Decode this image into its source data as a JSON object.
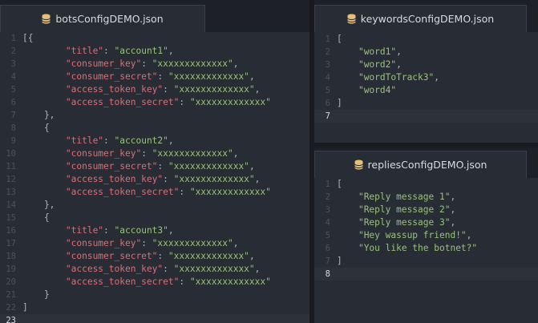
{
  "colors": {
    "key": "#e06c75",
    "string": "#98c379",
    "punctuation": "#abb2bf",
    "line_number": "#4b5263",
    "icon": "#e5c07b"
  },
  "left_pane": {
    "tab_title": "botsConfigDEMO.json",
    "tab_icon": "database-icon",
    "lines": [
      {
        "n": "1",
        "t": [
          [
            "p",
            "[{"
          ]
        ]
      },
      {
        "n": "2",
        "t": [
          [
            "p",
            "        "
          ],
          [
            "k",
            "\"title\""
          ],
          [
            "p",
            ": "
          ],
          [
            "s",
            "\"account1\""
          ],
          [
            "p",
            ","
          ]
        ]
      },
      {
        "n": "3",
        "t": [
          [
            "p",
            "        "
          ],
          [
            "k",
            "\"consumer_key\""
          ],
          [
            "p",
            ": "
          ],
          [
            "s",
            "\"xxxxxxxxxxxxx\""
          ],
          [
            "p",
            ","
          ]
        ]
      },
      {
        "n": "4",
        "t": [
          [
            "p",
            "        "
          ],
          [
            "k",
            "\"consumer_secret\""
          ],
          [
            "p",
            ": "
          ],
          [
            "s",
            "\"xxxxxxxxxxxxx\""
          ],
          [
            "p",
            ","
          ]
        ]
      },
      {
        "n": "5",
        "t": [
          [
            "p",
            "        "
          ],
          [
            "k",
            "\"access_token_key\""
          ],
          [
            "p",
            ": "
          ],
          [
            "s",
            "\"xxxxxxxxxxxxx\""
          ],
          [
            "p",
            ","
          ]
        ]
      },
      {
        "n": "6",
        "t": [
          [
            "p",
            "        "
          ],
          [
            "k",
            "\"access_token_secret\""
          ],
          [
            "p",
            ": "
          ],
          [
            "s",
            "\"xxxxxxxxxxxxx\""
          ]
        ]
      },
      {
        "n": "7",
        "t": [
          [
            "p",
            "    },"
          ]
        ]
      },
      {
        "n": "8",
        "t": [
          [
            "p",
            "    {"
          ]
        ]
      },
      {
        "n": "9",
        "t": [
          [
            "p",
            "        "
          ],
          [
            "k",
            "\"title\""
          ],
          [
            "p",
            ": "
          ],
          [
            "s",
            "\"account2\""
          ],
          [
            "p",
            ","
          ]
        ]
      },
      {
        "n": "10",
        "t": [
          [
            "p",
            "        "
          ],
          [
            "k",
            "\"consumer_key\""
          ],
          [
            "p",
            ": "
          ],
          [
            "s",
            "\"xxxxxxxxxxxxx\""
          ],
          [
            "p",
            ","
          ]
        ]
      },
      {
        "n": "11",
        "t": [
          [
            "p",
            "        "
          ],
          [
            "k",
            "\"consumer_secret\""
          ],
          [
            "p",
            ": "
          ],
          [
            "s",
            "\"xxxxxxxxxxxxx\""
          ],
          [
            "p",
            ","
          ]
        ]
      },
      {
        "n": "12",
        "t": [
          [
            "p",
            "        "
          ],
          [
            "k",
            "\"access_token_key\""
          ],
          [
            "p",
            ": "
          ],
          [
            "s",
            "\"xxxxxxxxxxxxx\""
          ],
          [
            "p",
            ","
          ]
        ]
      },
      {
        "n": "13",
        "t": [
          [
            "p",
            "        "
          ],
          [
            "k",
            "\"access_token_secret\""
          ],
          [
            "p",
            ": "
          ],
          [
            "s",
            "\"xxxxxxxxxxxxx\""
          ]
        ]
      },
      {
        "n": "14",
        "t": [
          [
            "p",
            "    },"
          ]
        ]
      },
      {
        "n": "15",
        "t": [
          [
            "p",
            "    {"
          ]
        ]
      },
      {
        "n": "16",
        "t": [
          [
            "p",
            "        "
          ],
          [
            "k",
            "\"title\""
          ],
          [
            "p",
            ": "
          ],
          [
            "s",
            "\"account3\""
          ],
          [
            "p",
            ","
          ]
        ]
      },
      {
        "n": "17",
        "t": [
          [
            "p",
            "        "
          ],
          [
            "k",
            "\"consumer_key\""
          ],
          [
            "p",
            ": "
          ],
          [
            "s",
            "\"xxxxxxxxxxxxx\""
          ],
          [
            "p",
            ","
          ]
        ]
      },
      {
        "n": "18",
        "t": [
          [
            "p",
            "        "
          ],
          [
            "k",
            "\"consumer_secret\""
          ],
          [
            "p",
            ": "
          ],
          [
            "s",
            "\"xxxxxxxxxxxxx\""
          ],
          [
            "p",
            ","
          ]
        ]
      },
      {
        "n": "19",
        "t": [
          [
            "p",
            "        "
          ],
          [
            "k",
            "\"access_token_key\""
          ],
          [
            "p",
            ": "
          ],
          [
            "s",
            "\"xxxxxxxxxxxxx\""
          ],
          [
            "p",
            ","
          ]
        ]
      },
      {
        "n": "20",
        "t": [
          [
            "p",
            "        "
          ],
          [
            "k",
            "\"access_token_secret\""
          ],
          [
            "p",
            ": "
          ],
          [
            "s",
            "\"xxxxxxxxxxxxx\""
          ]
        ]
      },
      {
        "n": "21",
        "t": [
          [
            "p",
            "    }"
          ]
        ]
      },
      {
        "n": "22",
        "t": [
          [
            "p",
            "]"
          ]
        ]
      },
      {
        "n": "23",
        "t": [],
        "current": true
      }
    ]
  },
  "top_right_pane": {
    "tab_title": "keywordsConfigDEMO.json",
    "tab_icon": "database-icon",
    "lines": [
      {
        "n": "1",
        "t": [
          [
            "p",
            "["
          ]
        ]
      },
      {
        "n": "2",
        "t": [
          [
            "p",
            "    "
          ],
          [
            "s",
            "\"word1\""
          ],
          [
            "p",
            ","
          ]
        ]
      },
      {
        "n": "3",
        "t": [
          [
            "p",
            "    "
          ],
          [
            "s",
            "\"word2\""
          ],
          [
            "p",
            ","
          ]
        ]
      },
      {
        "n": "4",
        "t": [
          [
            "p",
            "    "
          ],
          [
            "s",
            "\"wordToTrack3\""
          ],
          [
            "p",
            ","
          ]
        ]
      },
      {
        "n": "5",
        "t": [
          [
            "p",
            "    "
          ],
          [
            "s",
            "\"word4\""
          ]
        ]
      },
      {
        "n": "6",
        "t": [
          [
            "p",
            "]"
          ]
        ]
      },
      {
        "n": "7",
        "t": [],
        "current": true
      }
    ]
  },
  "bottom_right_pane": {
    "tab_title": "repliesConfigDEMO.json",
    "tab_icon": "database-icon",
    "lines": [
      {
        "n": "1",
        "t": [
          [
            "p",
            "["
          ]
        ]
      },
      {
        "n": "2",
        "t": [
          [
            "p",
            "    "
          ],
          [
            "s",
            "\"Reply message 1\""
          ],
          [
            "p",
            ","
          ]
        ]
      },
      {
        "n": "3",
        "t": [
          [
            "p",
            "    "
          ],
          [
            "s",
            "\"Reply message 2\""
          ],
          [
            "p",
            ","
          ]
        ]
      },
      {
        "n": "4",
        "t": [
          [
            "p",
            "    "
          ],
          [
            "s",
            "\"Reply message 3\""
          ],
          [
            "p",
            ","
          ]
        ]
      },
      {
        "n": "5",
        "t": [
          [
            "p",
            "    "
          ],
          [
            "s",
            "\"Hey wassup friend!\""
          ],
          [
            "p",
            ","
          ]
        ]
      },
      {
        "n": "6",
        "t": [
          [
            "p",
            "    "
          ],
          [
            "s",
            "\"You like the botnet?\""
          ]
        ]
      },
      {
        "n": "7",
        "t": [
          [
            "p",
            "]"
          ]
        ]
      },
      {
        "n": "8",
        "t": [],
        "current": true
      }
    ]
  }
}
